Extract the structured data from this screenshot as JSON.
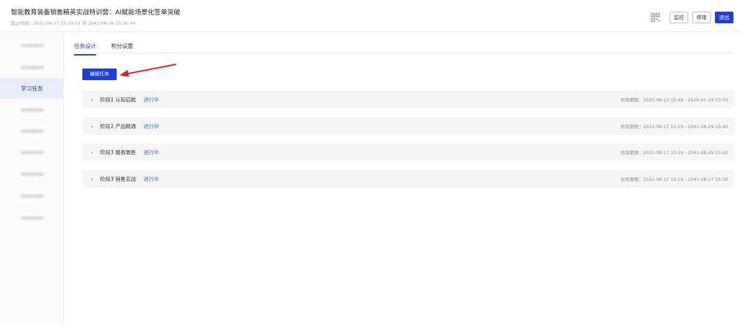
{
  "header": {
    "title": "智能教育装备销售精英实战特训营：AI赋能场景化签单突破",
    "subtitle": "起止时间：2021-08-17 15:19:01 至 2041-08-29 15:30:44",
    "buttons": {
      "monitor": "监控",
      "disable": "停用",
      "exit": "退出"
    }
  },
  "sidebar": {
    "active_label": "学习任务",
    "active_index": 2,
    "item_count": 9
  },
  "tabs": [
    {
      "label": "任务设计",
      "active": true
    },
    {
      "label": "积分设置",
      "active": false
    }
  ],
  "edit_button": "编辑任务",
  "stages": [
    {
      "name": "阶段1 认知启航",
      "status": "进行中",
      "period": "阶段期限：2025-09-10 15:48 - 2026-01-29 23:59"
    },
    {
      "name": "阶段2 产品精通",
      "status": "进行中",
      "period": "阶段期限：2021-08-17 15:19 - 2041-08-29 15:30"
    },
    {
      "name": "阶段3 服务致胜",
      "status": "进行中",
      "period": "阶段期限：2021-08-17 15:19 - 2041-08-29 15:30"
    },
    {
      "name": "阶段3 销售实战",
      "status": "进行中",
      "period": "阶段期限：2021-08-17 15:19 - 2041-08-17 15:30"
    }
  ],
  "colors": {
    "primary": "#1b3fd8",
    "status": "#2f6bdc",
    "arrow": "#e02020"
  }
}
